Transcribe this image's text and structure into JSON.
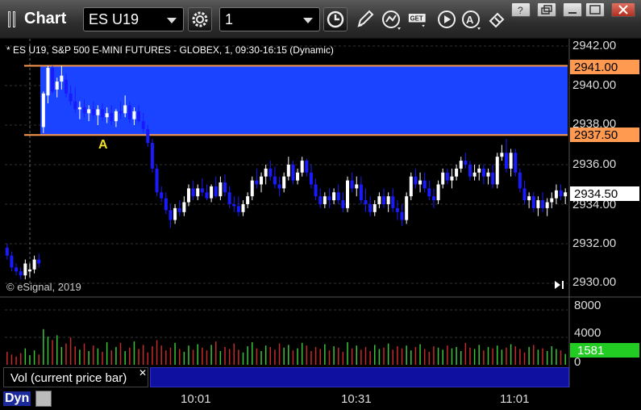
{
  "app": {
    "title": "Chart"
  },
  "symbol": {
    "value": "ES U19"
  },
  "interval": {
    "value": "1"
  },
  "chart": {
    "header": "* ES U19, S&P 500 E-MINI FUTURES - GLOBEX, 1, 09:30-16:15 (Dynamic)",
    "copyright": "© eSignal, 2019",
    "annotation": "A",
    "price_axis": [
      "2942.00",
      "2940.00",
      "2938.00",
      "2936.00",
      "2934.00",
      "2932.00",
      "2930.00"
    ],
    "levels": {
      "upper": "2941.00",
      "lower": "2937.50",
      "current": "2934.50"
    },
    "volume_axis": [
      "8000",
      "4000",
      "0"
    ],
    "current_volume": "1581",
    "time_axis": [
      "10:01",
      "10:31",
      "11:01"
    ],
    "colors": {
      "up": "#ffffff",
      "down": "#1a1aff",
      "zone": "#1a44ff",
      "level_line": "#ff9a50",
      "current_badge": "#ffffff",
      "volume_badge": "#22cc22"
    }
  },
  "volume_panel": {
    "label": "Vol (current price bar)"
  },
  "status": {
    "mode": "Dyn"
  },
  "chart_data": {
    "type": "candlestick",
    "title": "* ES U19, S&P 500 E-MINI FUTURES - GLOBEX, 1, 09:30-16:15 (Dynamic)",
    "x_ticks": [
      "10:01",
      "10:31",
      "11:01"
    ],
    "ylim": [
      2929.5,
      2942.5
    ],
    "volume_ylim": [
      0,
      8000
    ],
    "horizontal_levels": [
      2941.0,
      2937.5
    ],
    "last_price": 2934.5,
    "last_volume": 1581,
    "ohlc": [
      [
        2931.8,
        2932.0,
        2931.2,
        2931.4
      ],
      [
        2931.4,
        2931.6,
        2930.6,
        2930.8
      ],
      [
        2930.8,
        2931.0,
        2930.4,
        2930.6
      ],
      [
        2930.6,
        2930.8,
        2930.2,
        2930.4
      ],
      [
        2930.4,
        2931.2,
        2930.2,
        2931.0
      ],
      [
        2930.6,
        2931.0,
        2930.3,
        2930.7
      ],
      [
        2930.7,
        2931.4,
        2930.5,
        2931.2
      ],
      [
        2931.2,
        2931.5,
        2930.8,
        2931.0
      ],
      [
        2937.9,
        2939.7,
        2937.6,
        2939.6
      ],
      [
        2939.5,
        2941.0,
        2939.1,
        2940.9
      ],
      [
        2940.9,
        2941.0,
        2939.6,
        2939.7
      ],
      [
        2939.8,
        2940.4,
        2939.4,
        2940.2
      ],
      [
        2940.2,
        2941.0,
        2939.8,
        2940.5
      ],
      [
        2940.3,
        2940.6,
        2939.4,
        2939.6
      ],
      [
        2939.6,
        2940.0,
        2939.0,
        2939.2
      ],
      [
        2939.2,
        2939.9,
        2938.6,
        2938.8
      ],
      [
        2938.8,
        2939.2,
        2938.3,
        2938.9
      ],
      [
        2938.9,
        2939.3,
        2938.4,
        2938.6
      ],
      [
        2938.6,
        2939.0,
        2938.2,
        2938.8
      ],
      [
        2938.8,
        2939.2,
        2938.3,
        2938.5
      ],
      [
        2938.5,
        2939.0,
        2938.0,
        2938.8
      ],
      [
        2938.8,
        2939.1,
        2938.2,
        2938.4
      ],
      [
        2938.4,
        2938.9,
        2938.1,
        2938.6
      ],
      [
        2938.6,
        2939.0,
        2938.0,
        2938.2
      ],
      [
        2938.2,
        2938.8,
        2937.9,
        2938.7
      ],
      [
        2938.7,
        2939.2,
        2938.3,
        2938.6
      ],
      [
        2938.6,
        2939.5,
        2938.4,
        2939.0
      ],
      [
        2939.0,
        2939.2,
        2938.1,
        2938.3
      ],
      [
        2938.3,
        2938.9,
        2938.0,
        2938.7
      ],
      [
        2938.7,
        2939.0,
        2938.1,
        2938.2
      ],
      [
        2938.2,
        2938.6,
        2937.6,
        2937.8
      ],
      [
        2937.8,
        2938.0,
        2936.9,
        2937.1
      ],
      [
        2937.1,
        2937.3,
        2935.6,
        2935.8
      ],
      [
        2935.8,
        2936.0,
        2934.4,
        2934.6
      ],
      [
        2934.6,
        2934.9,
        2934.1,
        2934.3
      ],
      [
        2934.3,
        2934.6,
        2933.5,
        2933.7
      ],
      [
        2933.7,
        2934.0,
        2932.8,
        2933.2
      ],
      [
        2933.2,
        2934.0,
        2933.0,
        2933.8
      ],
      [
        2933.8,
        2934.2,
        2933.4,
        2933.6
      ],
      [
        2933.6,
        2934.4,
        2933.4,
        2934.1
      ],
      [
        2934.1,
        2935.0,
        2933.9,
        2934.8
      ],
      [
        2934.8,
        2935.2,
        2934.2,
        2934.4
      ],
      [
        2934.4,
        2935.0,
        2934.2,
        2934.8
      ],
      [
        2934.8,
        2935.3,
        2934.4,
        2934.6
      ],
      [
        2934.6,
        2935.0,
        2934.2,
        2934.3
      ],
      [
        2934.3,
        2935.0,
        2934.1,
        2934.9
      ],
      [
        2934.9,
        2935.4,
        2934.3,
        2934.4
      ],
      [
        2934.4,
        2935.4,
        2934.2,
        2935.1
      ],
      [
        2935.1,
        2935.5,
        2934.4,
        2934.6
      ],
      [
        2934.6,
        2934.9,
        2933.8,
        2934.0
      ],
      [
        2934.0,
        2934.4,
        2933.6,
        2933.9
      ],
      [
        2933.9,
        2934.4,
        2933.4,
        2933.6
      ],
      [
        2933.6,
        2934.2,
        2933.4,
        2934.0
      ],
      [
        2934.0,
        2934.6,
        2933.8,
        2934.4
      ],
      [
        2934.4,
        2935.4,
        2934.2,
        2935.2
      ],
      [
        2935.2,
        2935.8,
        2934.8,
        2935.0
      ],
      [
        2935.0,
        2935.6,
        2934.6,
        2935.4
      ],
      [
        2935.4,
        2936.0,
        2935.0,
        2935.8
      ],
      [
        2935.8,
        2936.2,
        2935.2,
        2935.4
      ],
      [
        2935.4,
        2935.9,
        2934.8,
        2935.0
      ],
      [
        2935.0,
        2935.4,
        2934.4,
        2934.8
      ],
      [
        2934.8,
        2935.6,
        2934.6,
        2935.4
      ],
      [
        2935.4,
        2936.4,
        2935.2,
        2936.0
      ],
      [
        2936.0,
        2936.2,
        2935.0,
        2935.2
      ],
      [
        2935.2,
        2935.8,
        2935.0,
        2935.6
      ],
      [
        2935.6,
        2936.4,
        2935.4,
        2936.2
      ],
      [
        2936.2,
        2936.3,
        2935.4,
        2935.6
      ],
      [
        2935.6,
        2936.0,
        2934.8,
        2935.0
      ],
      [
        2935.0,
        2935.3,
        2934.2,
        2934.4
      ],
      [
        2934.4,
        2934.8,
        2933.8,
        2934.0
      ],
      [
        2934.0,
        2934.6,
        2933.8,
        2934.4
      ],
      [
        2934.4,
        2934.8,
        2933.8,
        2934.2
      ],
      [
        2934.2,
        2934.8,
        2934.0,
        2934.6
      ],
      [
        2934.6,
        2935.0,
        2934.0,
        2934.2
      ],
      [
        2934.2,
        2934.6,
        2933.6,
        2933.8
      ],
      [
        2933.8,
        2935.4,
        2933.6,
        2935.2
      ],
      [
        2935.2,
        2935.6,
        2934.6,
        2934.8
      ],
      [
        2934.8,
        2935.4,
        2934.4,
        2935.0
      ],
      [
        2935.0,
        2935.4,
        2934.0,
        2934.2
      ],
      [
        2934.2,
        2934.8,
        2933.6,
        2934.0
      ],
      [
        2934.0,
        2934.4,
        2933.4,
        2933.6
      ],
      [
        2933.6,
        2934.2,
        2933.4,
        2934.0
      ],
      [
        2934.0,
        2934.6,
        2933.8,
        2934.4
      ],
      [
        2934.4,
        2934.8,
        2933.8,
        2934.0
      ],
      [
        2934.0,
        2934.6,
        2933.6,
        2934.4
      ],
      [
        2934.4,
        2934.8,
        2933.6,
        2933.8
      ],
      [
        2933.8,
        2934.2,
        2933.2,
        2933.6
      ],
      [
        2933.6,
        2934.0,
        2932.9,
        2933.2
      ],
      [
        2933.2,
        2934.6,
        2933.0,
        2934.4
      ],
      [
        2934.4,
        2935.6,
        2934.2,
        2935.4
      ],
      [
        2935.4,
        2935.8,
        2934.8,
        2935.0
      ],
      [
        2935.0,
        2935.6,
        2934.6,
        2935.2
      ],
      [
        2935.2,
        2935.6,
        2934.6,
        2934.8
      ],
      [
        2934.8,
        2935.2,
        2934.2,
        2934.4
      ],
      [
        2934.4,
        2934.8,
        2933.8,
        2934.2
      ],
      [
        2934.2,
        2935.2,
        2934.0,
        2935.0
      ],
      [
        2935.0,
        2935.8,
        2934.8,
        2935.6
      ],
      [
        2935.6,
        2935.8,
        2935.0,
        2935.2
      ],
      [
        2935.2,
        2935.8,
        2934.8,
        2935.4
      ],
      [
        2935.4,
        2936.0,
        2935.2,
        2935.8
      ],
      [
        2935.8,
        2936.4,
        2935.6,
        2936.2
      ],
      [
        2936.2,
        2936.6,
        2935.8,
        2936.0
      ],
      [
        2936.0,
        2936.2,
        2935.2,
        2935.4
      ],
      [
        2935.4,
        2936.0,
        2935.2,
        2935.6
      ],
      [
        2935.6,
        2936.0,
        2935.2,
        2935.8
      ],
      [
        2935.8,
        2936.0,
        2935.0,
        2935.4
      ],
      [
        2935.4,
        2935.8,
        2935.0,
        2935.6
      ],
      [
        2935.6,
        2936.0,
        2934.8,
        2935.0
      ],
      [
        2935.0,
        2936.6,
        2934.8,
        2936.4
      ],
      [
        2936.4,
        2937.0,
        2936.2,
        2936.6
      ],
      [
        2936.6,
        2937.3,
        2935.6,
        2935.8
      ],
      [
        2935.8,
        2936.8,
        2935.4,
        2936.6
      ],
      [
        2936.6,
        2936.8,
        2935.4,
        2935.6
      ],
      [
        2935.6,
        2935.8,
        2934.6,
        2934.8
      ],
      [
        2934.8,
        2935.2,
        2934.0,
        2934.2
      ],
      [
        2934.2,
        2934.6,
        2933.8,
        2934.4
      ],
      [
        2934.4,
        2934.6,
        2933.6,
        2933.8
      ],
      [
        2933.8,
        2934.4,
        2933.4,
        2934.2
      ],
      [
        2934.2,
        2934.6,
        2933.6,
        2933.8
      ],
      [
        2933.8,
        2934.3,
        2933.4,
        2934.1
      ],
      [
        2934.1,
        2934.6,
        2933.8,
        2934.3
      ],
      [
        2934.3,
        2935.0,
        2934.0,
        2934.7
      ],
      [
        2934.7,
        2935.0,
        2934.2,
        2934.4
      ],
      [
        2934.4,
        2934.8,
        2934.0,
        2934.6
      ]
    ],
    "volume": [
      1900,
      1500,
      1200,
      1700,
      2400,
      1400,
      2100,
      1500,
      5200,
      4100,
      3600,
      4300,
      2600,
      3100,
      4000,
      2700,
      2200,
      3100,
      2000,
      2800,
      2400,
      1900,
      3300,
      2100,
      2600,
      3200,
      2000,
      2500,
      3400,
      2300,
      2900,
      1800,
      2700,
      3600,
      2800,
      2100,
      2500,
      3200,
      2300,
      1900,
      2800,
      2200,
      3000,
      2500,
      2100,
      2900,
      3400,
      2000,
      2600,
      2300,
      3100,
      2200,
      1800,
      2700,
      3300,
      2400,
      2000,
      2800,
      2600,
      2200,
      3100,
      2500,
      2900,
      2100,
      2400,
      3200,
      2800,
      2000,
      2600,
      2300,
      3000,
      2100,
      2700,
      2500,
      1900,
      3300,
      2400,
      2800,
      2200,
      2600,
      2000,
      2900,
      2300,
      2500,
      3100,
      2200,
      2700,
      2400,
      2800,
      2100,
      2600,
      3000,
      2300,
      1900,
      2700,
      2500,
      2200,
      2800,
      2400,
      2600,
      2000,
      3200,
      2500,
      2300,
      2900,
      2100,
      2600,
      2400,
      2800,
      2200,
      2500,
      3000,
      2700,
      2300,
      1800,
      2600,
      2900,
      2200,
      2400,
      2000,
      2700,
      2300,
      2100,
      1581
    ]
  }
}
